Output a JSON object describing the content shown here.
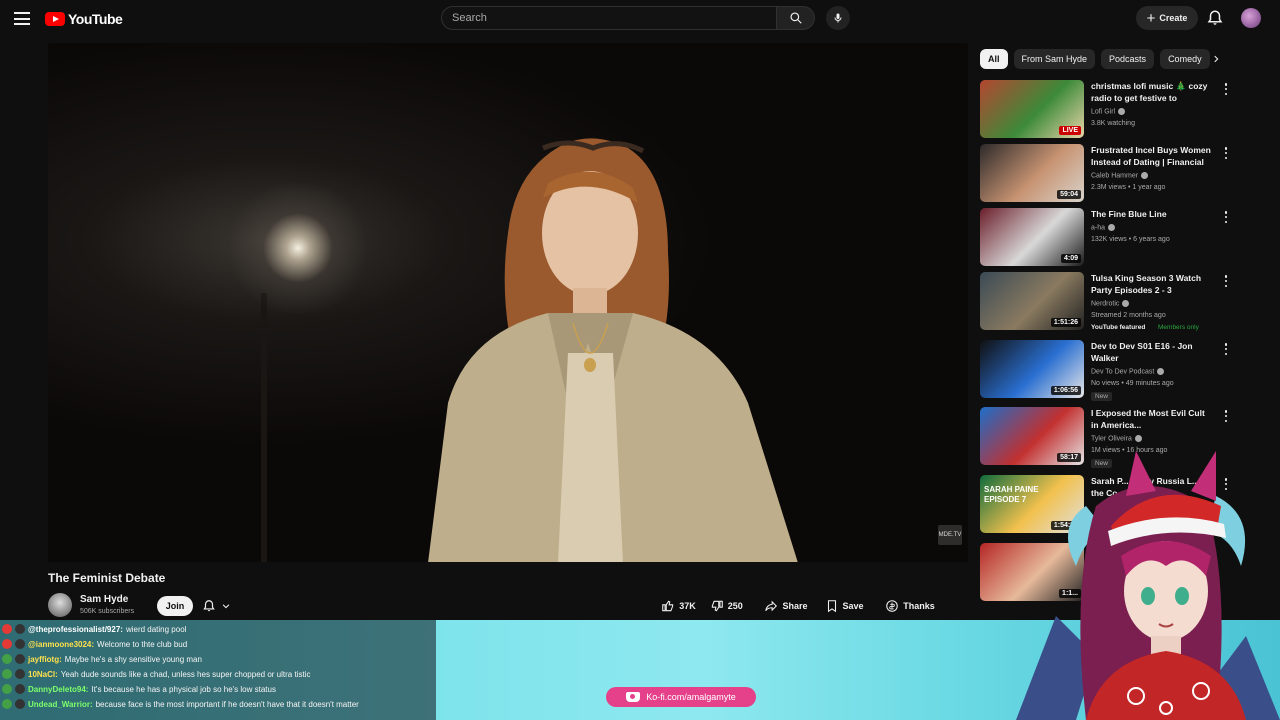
{
  "header": {
    "logo_text": "YouTube",
    "search_placeholder": "Search",
    "create_label": "Create"
  },
  "video": {
    "title": "The Feminist Debate",
    "watermark": "MDE.TV",
    "channel": {
      "name": "Sam Hyde",
      "subscribers": "506K subscribers",
      "join_label": "Join"
    },
    "actions": {
      "likes": "37K",
      "dislikes": "250",
      "share_label": "Share",
      "save_label": "Save",
      "thanks_label": "Thanks"
    }
  },
  "sidebar": {
    "chips": [
      "All",
      "From Sam Hyde",
      "Podcasts",
      "Comedy"
    ],
    "recommendations": [
      {
        "title": "christmas lofi music 🎄 cozy radio to get festive to",
        "channel": "Lofi Girl",
        "meta": "3.8K watching",
        "duration": "LIVE",
        "live": true,
        "thumb_colors": [
          "#b5462f",
          "#3c8a3a",
          "#e8d5a8"
        ]
      },
      {
        "title": "Frustrated Incel Buys Women Instead of Dating | Financial ...",
        "channel": "Caleb Hammer",
        "meta": "2.3M views • 1 year ago",
        "duration": "59:04",
        "thumb_colors": [
          "#2d2a2a",
          "#c79372",
          "#d9d4cc"
        ]
      },
      {
        "title": "The Fine Blue Line",
        "channel": "a-ha",
        "meta": "132K views • 6 years ago",
        "duration": "4:09",
        "thumb_colors": [
          "#6b1e2a",
          "#d8d8d8",
          "#1a1a1a"
        ]
      },
      {
        "title": "Tulsa King Season 3 Watch Party Episodes 2 - 3",
        "channel": "Nerdrotic",
        "meta": "Streamed 2 months ago",
        "duration": "1:51:26",
        "featured": "YouTube featured",
        "members": "Members only",
        "thumb_colors": [
          "#3a4a55",
          "#8a7a60",
          "#222"
        ]
      },
      {
        "title": "Dev to Dev S01 E16 - Jon Walker",
        "channel": "Dev To Dev Podcast",
        "meta": "No views • 49 minutes ago",
        "duration": "1:06:56",
        "badge": "New",
        "thumb_colors": [
          "#101010",
          "#2a6fd1",
          "#e8e8e8"
        ]
      },
      {
        "title": "I Exposed the Most Evil Cult in America...",
        "channel": "Tyler Oliveira",
        "meta": "1M views • 16 hours ago",
        "duration": "58:17",
        "badge": "New",
        "thumb_colors": [
          "#1d6ec9",
          "#c23030",
          "#e5e5e5"
        ]
      },
      {
        "title": "Sarah P... - Why Russia L... the Co...",
        "channel": "",
        "meta": "",
        "duration": "1:54:55",
        "thumb_overlay": "SARAH PAINE EPISODE 7",
        "thumb_colors": [
          "#0f6b3c",
          "#f2c14e",
          "#e0e0e0"
        ]
      },
      {
        "title": "",
        "channel": "",
        "meta": "",
        "duration": "1:1...",
        "thumb_colors": [
          "#b52626",
          "#e6b99a",
          "#222"
        ]
      }
    ]
  },
  "overlay": {
    "chat": [
      {
        "user": "@theprofessionalist/927:",
        "msg": "wierd dating pool",
        "color": "#ffffff"
      },
      {
        "user": "@ianmoone3024:",
        "msg": "Welcome to thte club bud",
        "color": "#ffe14d"
      },
      {
        "user": "jayffiotg:",
        "msg": "Maybe he's a shy sensitive young man",
        "color": "#ffe14d"
      },
      {
        "user": "10NaCl:",
        "msg": "Yeah dude sounds like a chad, unless hes super chopped or ultra tistic",
        "color": "#ffe14d"
      },
      {
        "user": "DannyDeleto94:",
        "msg": "It's because he has a physical job so he's low status",
        "color": "#7cff6b"
      },
      {
        "user": "Undead_Warrior:",
        "msg": "because face is the most important if he doesn't have that it doesn't matter",
        "color": "#7cff6b"
      }
    ],
    "kofi": "Ko-fi.com/amalgamyte"
  },
  "colors": {
    "background": "#0f0f0f",
    "accent": "#ff0000",
    "text": "#f1f1f1",
    "secondary_text": "#aaaaaa",
    "overlay_cyan": "#7fe4ec",
    "kofi_pink": "#e5408a"
  }
}
